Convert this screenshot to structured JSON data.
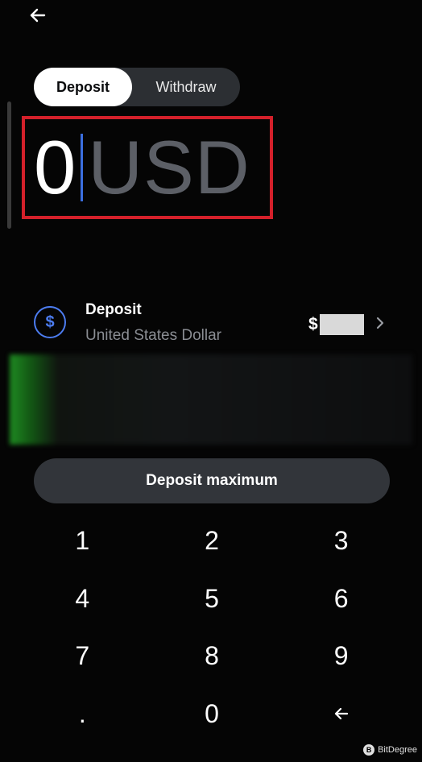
{
  "tabs": [
    {
      "label": "Deposit",
      "active": true
    },
    {
      "label": "Withdraw",
      "active": false
    }
  ],
  "amount": {
    "value": "0",
    "currency": "USD"
  },
  "asset": {
    "icon": "dollar-icon",
    "icon_glyph": "$",
    "title": "Deposit",
    "subtitle": "United States Dollar",
    "balance_prefix": "$"
  },
  "deposit_max_label": "Deposit maximum",
  "keypad": [
    "1",
    "2",
    "3",
    "4",
    "5",
    "6",
    "7",
    "8",
    "9",
    ".",
    "0"
  ],
  "watermark": {
    "logo_glyph": "B",
    "text": "BitDegree"
  },
  "colors": {
    "accent_blue": "#4c7cf0",
    "highlight_red": "#d4202a",
    "button_bg": "#32353a"
  }
}
